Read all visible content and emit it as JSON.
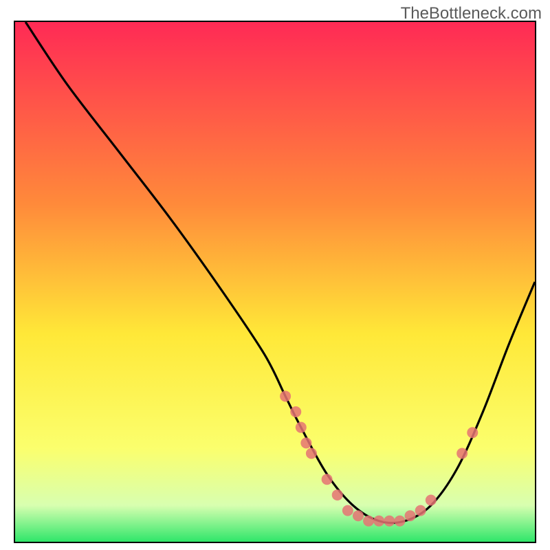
{
  "watermark": "TheBottleneck.com",
  "chart_data": {
    "type": "line",
    "title": "",
    "xlabel": "",
    "ylabel": "",
    "xlim": [
      0,
      100
    ],
    "ylim": [
      0,
      100
    ],
    "background_gradient": {
      "stops": [
        {
          "offset": 0,
          "color": "#ff2a55"
        },
        {
          "offset": 35,
          "color": "#ff8a3a"
        },
        {
          "offset": 60,
          "color": "#ffe838"
        },
        {
          "offset": 82,
          "color": "#fbff6d"
        },
        {
          "offset": 93,
          "color": "#d8ffb0"
        },
        {
          "offset": 100,
          "color": "#2fe66a"
        }
      ]
    },
    "series": [
      {
        "name": "bottleneck-curve",
        "x": [
          2,
          10,
          20,
          30,
          40,
          48,
          52,
          55,
          60,
          65,
          70,
          75,
          80,
          85,
          90,
          95,
          100
        ],
        "y": [
          100,
          88,
          75,
          62,
          48,
          36,
          28,
          22,
          13,
          7,
          4,
          4,
          7,
          14,
          25,
          38,
          50
        ]
      }
    ],
    "markers": {
      "name": "sample-points",
      "color": "#e57373",
      "points": [
        {
          "x": 52,
          "y": 28
        },
        {
          "x": 54,
          "y": 25
        },
        {
          "x": 55,
          "y": 22
        },
        {
          "x": 56,
          "y": 19
        },
        {
          "x": 57,
          "y": 17
        },
        {
          "x": 60,
          "y": 12
        },
        {
          "x": 62,
          "y": 9
        },
        {
          "x": 64,
          "y": 6
        },
        {
          "x": 66,
          "y": 5
        },
        {
          "x": 68,
          "y": 4
        },
        {
          "x": 70,
          "y": 4
        },
        {
          "x": 72,
          "y": 4
        },
        {
          "x": 74,
          "y": 4
        },
        {
          "x": 76,
          "y": 5
        },
        {
          "x": 78,
          "y": 6
        },
        {
          "x": 80,
          "y": 8
        },
        {
          "x": 86,
          "y": 17
        },
        {
          "x": 88,
          "y": 21
        }
      ]
    }
  }
}
